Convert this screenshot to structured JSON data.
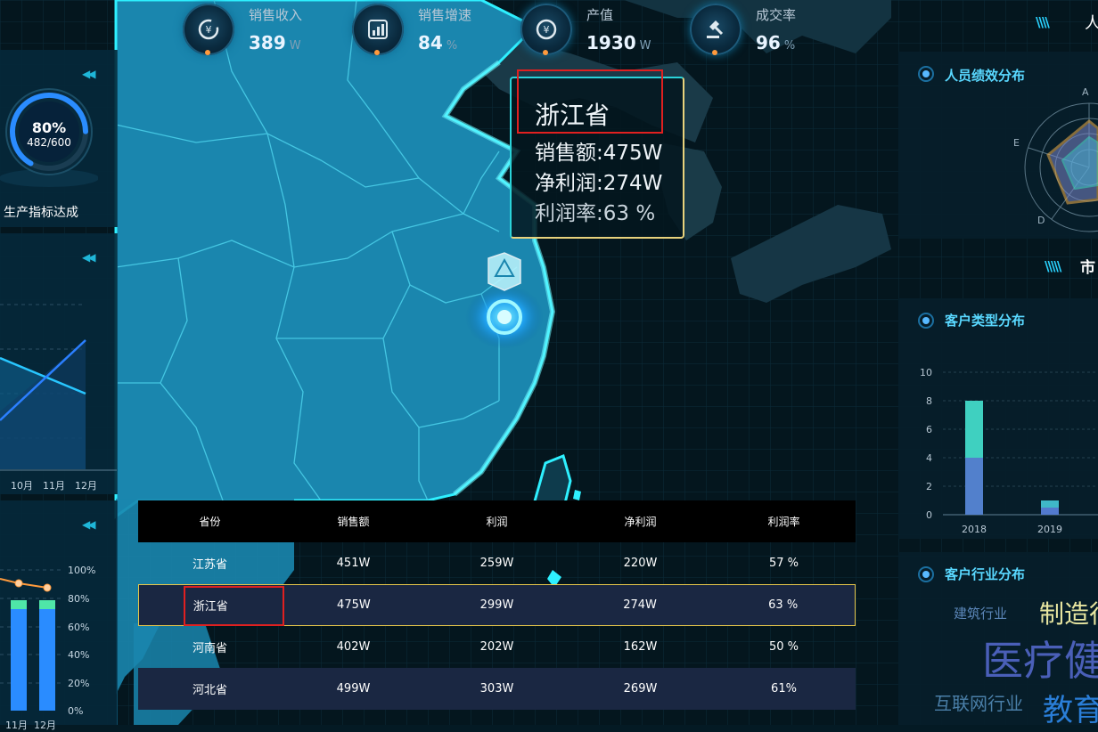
{
  "kpis": [
    {
      "label": "销售收入",
      "value": "389",
      "unit": "W",
      "icon": "revenue-icon"
    },
    {
      "label": "销售增速",
      "value": "84",
      "unit": "%",
      "icon": "growth-bars-icon"
    },
    {
      "label": "产值",
      "value": "1930",
      "unit": "W",
      "icon": "yen-coin-icon"
    },
    {
      "label": "成交率",
      "value": "96",
      "unit": "%",
      "icon": "gavel-icon"
    }
  ],
  "gauge": {
    "percent": "80%",
    "fraction": "482/600",
    "caption": "生产指标达成",
    "progress": 0.8
  },
  "line_panel": {
    "months": [
      "10月",
      "11月",
      "12月"
    ]
  },
  "bar_panel": {
    "y_ticks": [
      "100%",
      "80%",
      "60%",
      "40%",
      "20%",
      "0%"
    ],
    "months": [
      "11月",
      "12月"
    ]
  },
  "tooltip": {
    "province": "浙江省",
    "sales_label": "销售额:475W",
    "net_profit_label": "净利润:274W",
    "margin_label": "利润率:63 %"
  },
  "table": {
    "headers": [
      "省份",
      "销售额",
      "利润",
      "净利润",
      "利润率"
    ],
    "rows": [
      [
        "江苏省",
        "451W",
        "259W",
        "220W",
        "57 %"
      ],
      [
        "浙江省",
        "475W",
        "299W",
        "274W",
        "63 %"
      ],
      [
        "河南省",
        "402W",
        "202W",
        "162W",
        "50 %"
      ],
      [
        "河北省",
        "499W",
        "303W",
        "269W",
        "61%"
      ]
    ],
    "selected_index": 1
  },
  "right": {
    "top_label": "人",
    "panel1_title": "人员绩效分布",
    "radar_axes": [
      "A",
      "E",
      "D"
    ],
    "middle_label": "市",
    "panel2_title": "客户类型分布",
    "panel3_title": "客户行业分布"
  },
  "chart_data": {
    "type": "bar",
    "categories": [
      "2018",
      "2019"
    ],
    "values": [
      8,
      1
    ],
    "ylim": [
      0,
      10
    ],
    "y_ticks": [
      "10",
      "8",
      "6",
      "4",
      "2",
      "0"
    ]
  },
  "word_cloud": [
    {
      "text": "建筑行业",
      "color": "#5b86b8"
    },
    {
      "text": "制造行",
      "color": "#e8e6a0"
    },
    {
      "text": "医疗健",
      "color": "#4a5fb8"
    },
    {
      "text": "互联网行业",
      "color": "#4a7fa8"
    },
    {
      "text": "教育",
      "color": "#2a7ed8"
    }
  ],
  "colors": {
    "accent": "#2ad3d9",
    "highlight": "#e6c64a",
    "map": "#1a86ae",
    "orange": "#ff9a3c"
  }
}
